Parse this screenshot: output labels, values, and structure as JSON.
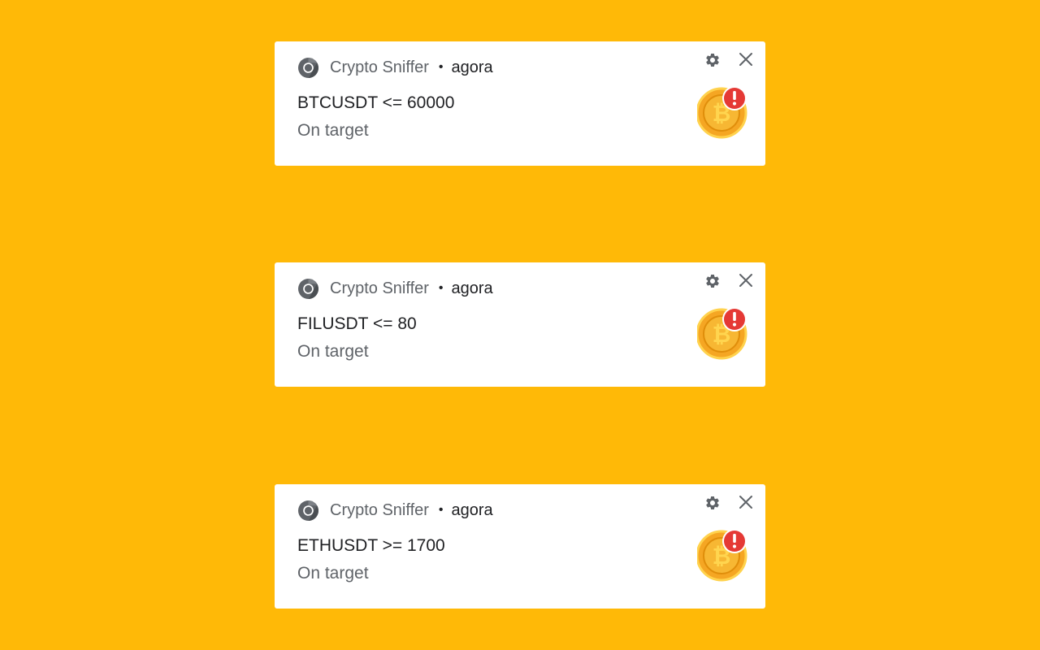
{
  "background_color": "#FFB907",
  "notifications": [
    {
      "app_name": "Crypto Sniffer",
      "separator": "•",
      "origin": "agora",
      "title": "BTCUSDT <= 60000",
      "message": "On target",
      "settings_icon": "gear-icon",
      "close_icon": "close-icon",
      "app_icon": "chrome-icon",
      "image_icon": "bitcoin-alert-icon"
    },
    {
      "app_name": "Crypto Sniffer",
      "separator": "•",
      "origin": "agora",
      "title": "FILUSDT <= 80",
      "message": "On target",
      "settings_icon": "gear-icon",
      "close_icon": "close-icon",
      "app_icon": "chrome-icon",
      "image_icon": "bitcoin-alert-icon"
    },
    {
      "app_name": "Crypto Sniffer",
      "separator": "•",
      "origin": "agora",
      "title": "ETHUSDT >= 1700",
      "message": "On target",
      "settings_icon": "gear-icon",
      "close_icon": "close-icon",
      "app_icon": "chrome-icon",
      "image_icon": "bitcoin-alert-icon"
    }
  ]
}
